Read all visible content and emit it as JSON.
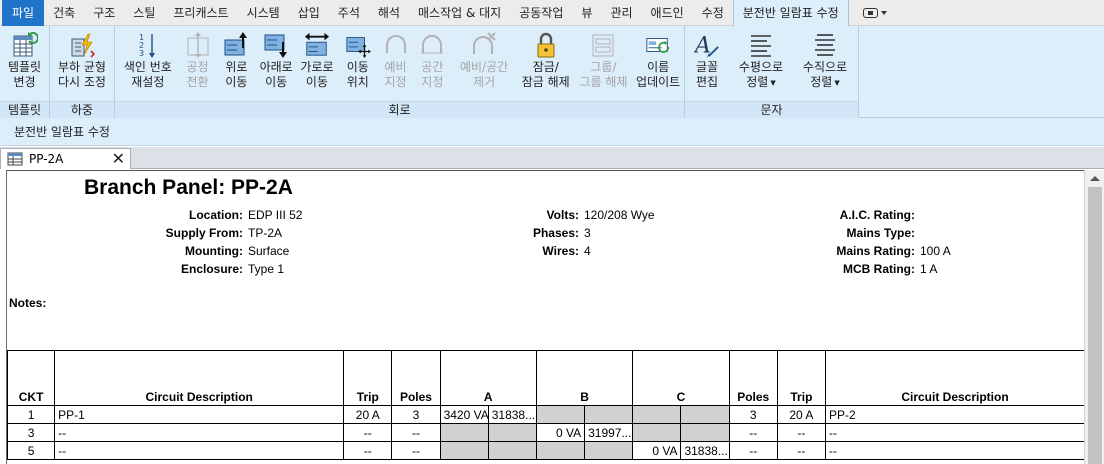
{
  "menubar": {
    "items": [
      "파일",
      "건축",
      "구조",
      "스틸",
      "프리캐스트",
      "시스템",
      "삽입",
      "주석",
      "해석",
      "매스작업 & 대지",
      "공동작업",
      "뷰",
      "관리",
      "애드인",
      "수정",
      "분전반 일람표 수정"
    ]
  },
  "ribbon": {
    "groups": [
      {
        "label": "템플릿",
        "tools": [
          {
            "line1": "템플릿",
            "line2": "변경",
            "icon": "template-icon"
          }
        ]
      },
      {
        "label": "하중",
        "tools": [
          {
            "line1": "부하 균형",
            "line2": "다시 조정",
            "icon": "rebalance-icon"
          }
        ]
      },
      {
        "label": "회로",
        "tools": [
          {
            "line1": "색인 번호",
            "line2": "재설정",
            "icon": "renumber-icon"
          },
          {
            "line1": "공정",
            "line2": "전환",
            "icon": "phase-toggle-icon",
            "disabled": true
          },
          {
            "line1": "위로",
            "line2": "이동",
            "icon": "move-up-icon"
          },
          {
            "line1": "아래로",
            "line2": "이동",
            "icon": "move-down-icon"
          },
          {
            "line1": "가로로",
            "line2": "이동",
            "icon": "move-across-icon"
          },
          {
            "line1": "이동",
            "line2": "위치",
            "icon": "move-to-icon"
          },
          {
            "line1": "예비",
            "line2": "지정",
            "icon": "assign-spare-icon",
            "disabled": true
          },
          {
            "line1": "공간",
            "line2": "지정",
            "icon": "assign-space-icon",
            "disabled": true
          },
          {
            "line1": "예비/공간",
            "line2": "제거",
            "icon": "remove-spare-icon",
            "disabled": true
          },
          {
            "line1": "잠금/",
            "line2": "잠금 해제",
            "icon": "lock-icon"
          },
          {
            "line1": "그룹/",
            "line2": "그룹 해제",
            "icon": "group-icon",
            "disabled": true
          },
          {
            "line1": "이름",
            "line2": "업데이트",
            "icon": "update-names-icon"
          }
        ]
      },
      {
        "label": "문자",
        "tools": [
          {
            "line1": "글꼴",
            "line2": "편집",
            "icon": "font-icon"
          },
          {
            "line1": "수평으로",
            "line2": "정렬",
            "icon": "align-horizontal-icon",
            "dropdown": true
          },
          {
            "line1": "수직으로",
            "line2": "정렬",
            "icon": "align-vertical-icon",
            "dropdown": true
          }
        ]
      }
    ]
  },
  "context_label": "분전반 일람표 수정",
  "document_tab": {
    "name": "PP-2A",
    "close": "✕"
  },
  "panel": {
    "title": "Branch Panel: PP-2A",
    "fields_left": [
      {
        "label": "Location:",
        "value": "EDP III 52"
      },
      {
        "label": "Supply From:",
        "value": "TP-2A"
      },
      {
        "label": "Mounting:",
        "value": "Surface"
      },
      {
        "label": "Enclosure:",
        "value": "Type 1"
      }
    ],
    "fields_middle": [
      {
        "label": "Volts:",
        "value": "120/208 Wye"
      },
      {
        "label": "Phases:",
        "value": "3"
      },
      {
        "label": "Wires:",
        "value": "4"
      }
    ],
    "fields_right": [
      {
        "label": "A.I.C. Rating:",
        "value": ""
      },
      {
        "label": "Mains Type:",
        "value": ""
      },
      {
        "label": "Mains Rating:",
        "value": "100 A"
      },
      {
        "label": "MCB Rating:",
        "value": "1 A"
      }
    ],
    "notes_label": "Notes:"
  },
  "schedule": {
    "headers": [
      "CKT",
      "Circuit Description",
      "Trip",
      "Poles",
      "A",
      "B",
      "C",
      "Poles",
      "Trip",
      "Circuit Description"
    ],
    "rows": [
      {
        "ckt": "1",
        "desc": "PP-1",
        "trip": "20 A",
        "poles": "3",
        "a1": "3420 VA",
        "a2": "31838...",
        "b1": "",
        "b2": "",
        "c1": "",
        "c2": "",
        "poles_r": "3",
        "trip_r": "20 A",
        "desc_r": "PP-2"
      },
      {
        "ckt": "3",
        "desc": "--",
        "trip": "--",
        "poles": "--",
        "a1": "",
        "a2": "",
        "b1": "0 VA",
        "b2": "31997...",
        "c1": "",
        "c2": "",
        "poles_r": "--",
        "trip_r": "--",
        "desc_r": "--"
      },
      {
        "ckt": "5",
        "desc": "--",
        "trip": "--",
        "poles": "--",
        "a1": "",
        "a2": "",
        "b1": "",
        "b2": "",
        "c1": "0 VA",
        "c2": "31838...",
        "poles_r": "--",
        "trip_r": "--",
        "desc_r": "--"
      }
    ]
  },
  "colors": {
    "ribbon_bg": "#ddeefb",
    "file_tab": "#1f73c9",
    "shaded_cell": "#d1d1d1"
  }
}
